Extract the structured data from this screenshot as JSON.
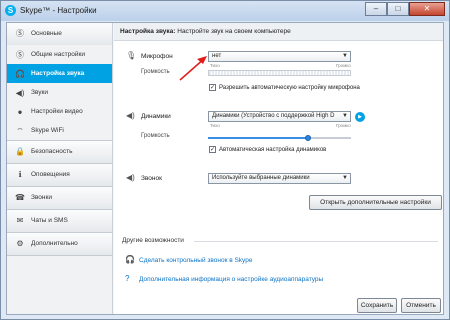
{
  "window": {
    "title": "Skype™ - Настройки",
    "icon": "skype-icon",
    "buttons": {
      "minimize": "–",
      "maximize": "□",
      "close": "✕"
    }
  },
  "sidebar": {
    "groups": [
      {
        "head": {
          "label": "Основные",
          "icon": "skype-icon"
        },
        "items": [
          {
            "label": "Общие настройки",
            "icon": "skype-icon"
          },
          {
            "label": "Настройка звука",
            "icon": "headset-icon",
            "active": true
          },
          {
            "label": "Звуки",
            "icon": "speaker-icon"
          },
          {
            "label": "Настройки видео",
            "icon": "camera-icon"
          },
          {
            "label": "Skype WiFi",
            "icon": "wifi-icon"
          }
        ]
      },
      {
        "head": {
          "label": "Безопасность",
          "icon": "lock-icon"
        },
        "items": []
      },
      {
        "head": {
          "label": "Оповещения",
          "icon": "info-icon"
        },
        "items": []
      },
      {
        "head": {
          "label": "Звонки",
          "icon": "phone-icon"
        },
        "items": []
      },
      {
        "head": {
          "label": "Чаты и SMS",
          "icon": "chat-icon"
        },
        "items": []
      },
      {
        "head": {
          "label": "Дополнительно",
          "icon": "gear-icon"
        },
        "items": []
      }
    ]
  },
  "header": {
    "bold": "Настройка звука:",
    "text": " Настройте звук на своем компьютере"
  },
  "microphone": {
    "label": "Микрофон",
    "icon": "microphone-icon",
    "selected": "нет",
    "volume_label": "Громкость",
    "quiet": "Тихо",
    "loud": "Громко",
    "auto_label": "Разрешить автоматическую настройку микрофона",
    "auto_checked": true
  },
  "speakers": {
    "label": "Динамики",
    "icon": "speaker-icon",
    "selected": "Динамики (Устройство с поддержкой High D",
    "volume_label": "Громкость",
    "quiet": "Тихо",
    "loud": "Громко",
    "volume_fraction": 0.7,
    "auto_label": "Автоматическая настройка динамиков",
    "auto_checked": true
  },
  "ringer": {
    "label": "Звонок",
    "icon": "speaker-icon",
    "selected": "Используйте выбранные динамики"
  },
  "more_settings_button": "Открыть дополнительные настройки",
  "other": {
    "title": "Другие возможности",
    "links": [
      {
        "label": "Сделать контрольный звонок в Skype",
        "icon": "headset-icon"
      },
      {
        "label": "Дополнительная информация о настройке аудиоаппаратуры",
        "icon": "help-icon"
      }
    ]
  },
  "footer": {
    "save": "Сохранить",
    "cancel": "Отменить"
  },
  "colors": {
    "accent": "#00a2e4",
    "link": "#0b73c7",
    "annotation_arrow": "#e21b1b"
  }
}
